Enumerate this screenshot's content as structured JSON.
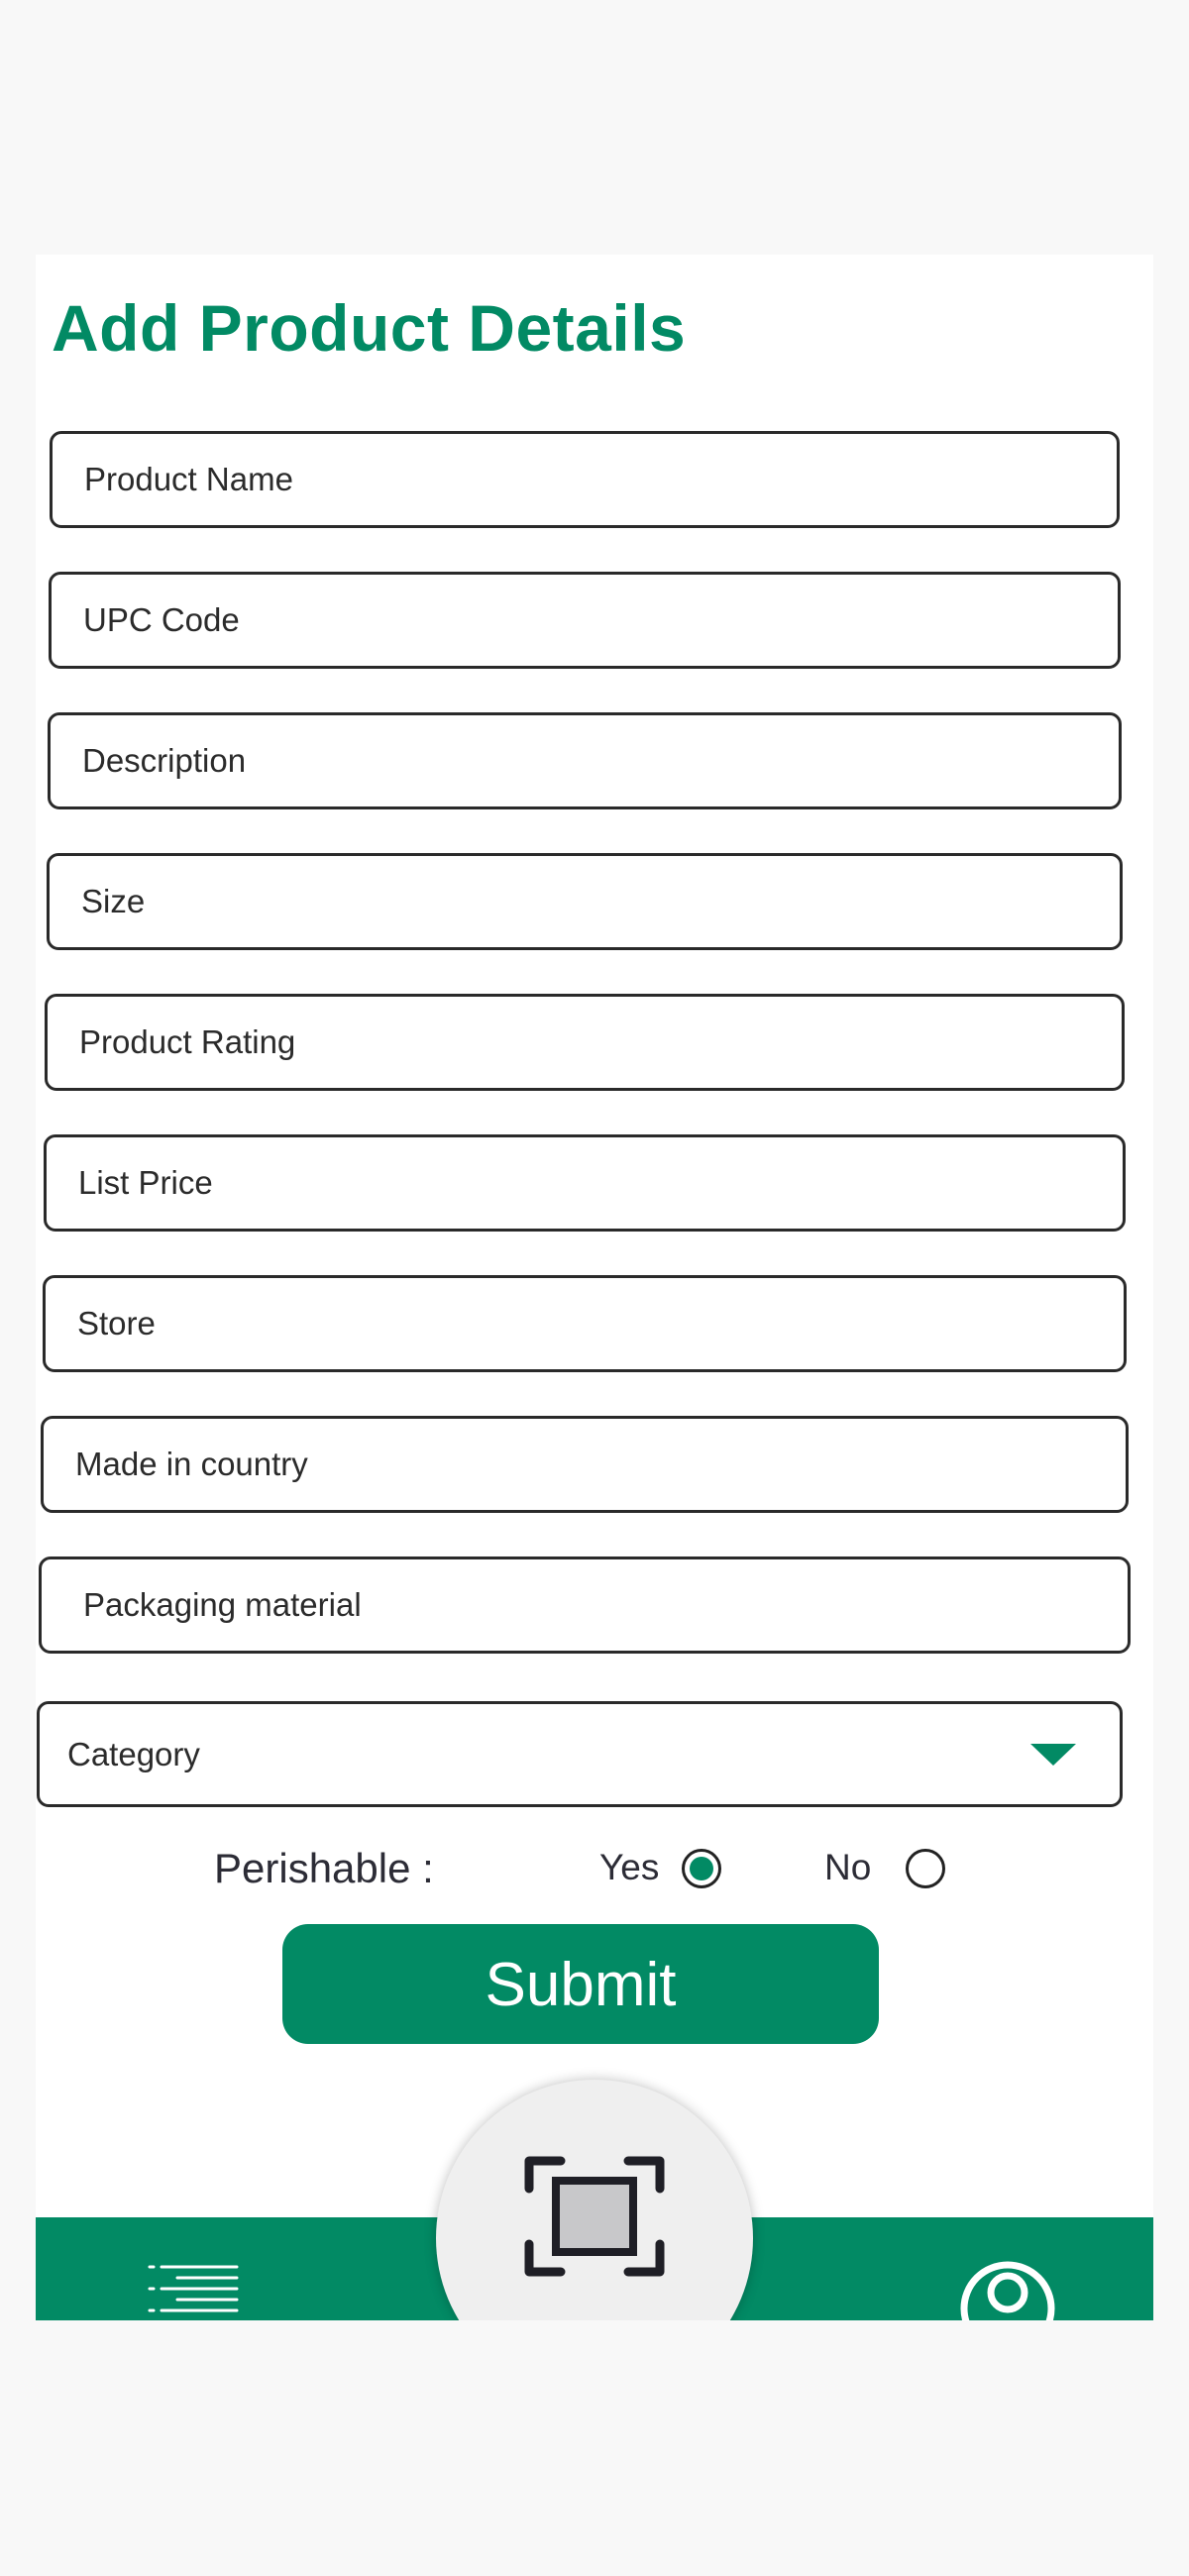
{
  "page": {
    "title": "Add Product Details"
  },
  "form": {
    "fields": [
      {
        "placeholder": "Product Name",
        "value": ""
      },
      {
        "placeholder": "UPC Code",
        "value": ""
      },
      {
        "placeholder": "Description",
        "value": ""
      },
      {
        "placeholder": "Size",
        "value": ""
      },
      {
        "placeholder": "Product Rating",
        "value": ""
      },
      {
        "placeholder": "List Price",
        "value": ""
      },
      {
        "placeholder": "Store",
        "value": ""
      },
      {
        "placeholder": "Made in country",
        "value": ""
      },
      {
        "placeholder": "Packaging material",
        "value": ""
      }
    ],
    "category": {
      "label": "Category",
      "icon": "chevron-down-icon"
    },
    "perishable": {
      "label": "Perishable :",
      "options": [
        {
          "label": "Yes",
          "selected": true
        },
        {
          "label": "No",
          "selected": false
        }
      ]
    },
    "submit_label": "Submit"
  },
  "bottom_nav": {
    "items": [
      {
        "icon": "menu-icon"
      },
      {
        "icon": "scan-icon"
      },
      {
        "icon": "profile-icon"
      }
    ]
  },
  "colors": {
    "accent": "#028a64",
    "background": "#f8f8f8",
    "card": "#ffffff",
    "field_border": "#2a2a2a",
    "fab": "#efefef"
  }
}
